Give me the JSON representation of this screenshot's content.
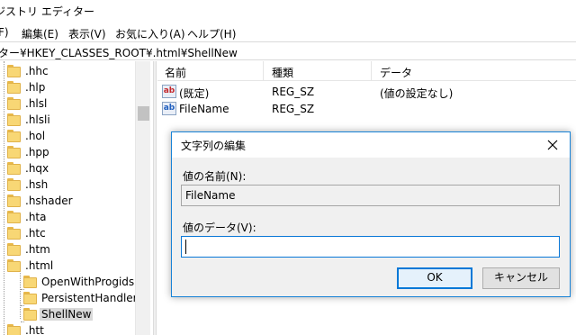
{
  "window": {
    "title": "ジストリ エディター"
  },
  "menu": {
    "items": [
      {
        "label": "F)"
      },
      {
        "label": "編集(E)"
      },
      {
        "label": "表示(V)"
      },
      {
        "label": "お気に入り(A)"
      },
      {
        "label": "ヘルプ(H)"
      }
    ]
  },
  "address": {
    "path": "ター¥HKEY_CLASSES_ROOT¥.html¥ShellNew"
  },
  "tree": {
    "items": [
      {
        "label": ".hhc"
      },
      {
        "label": ".hlp"
      },
      {
        "label": ".hlsl"
      },
      {
        "label": ".hlsli"
      },
      {
        "label": ".hol"
      },
      {
        "label": ".hpp"
      },
      {
        "label": ".hqx"
      },
      {
        "label": ".hsh"
      },
      {
        "label": ".hshader"
      },
      {
        "label": ".hta"
      },
      {
        "label": ".htc"
      },
      {
        "label": ".htm"
      },
      {
        "label": ".html"
      },
      {
        "label": "OpenWithProgids"
      },
      {
        "label": "PersistentHandler"
      },
      {
        "label": "ShellNew"
      },
      {
        "label": ".htt"
      }
    ],
    "selected": "ShellNew"
  },
  "list": {
    "columns": {
      "name": "名前",
      "type": "種類",
      "data": "データ"
    },
    "rows": [
      {
        "icon": "string-value-icon",
        "name": "(既定)",
        "type": "REG_SZ",
        "data": "(値の設定なし)"
      },
      {
        "icon": "string-value-icon",
        "name": "FileName",
        "type": "REG_SZ",
        "data": ""
      }
    ]
  },
  "dialog": {
    "title": "文字列の編集",
    "name_label": "値の名前(N):",
    "name_value": "FileName",
    "data_label": "値のデータ(V):",
    "data_value": "",
    "ok_label": "OK",
    "cancel_label": "キャンセル"
  },
  "colors": {
    "accent": "#0078d7",
    "selection": "#d9d9d9",
    "dialog_bg": "#f0f0f0",
    "folder": "#f8d775"
  }
}
